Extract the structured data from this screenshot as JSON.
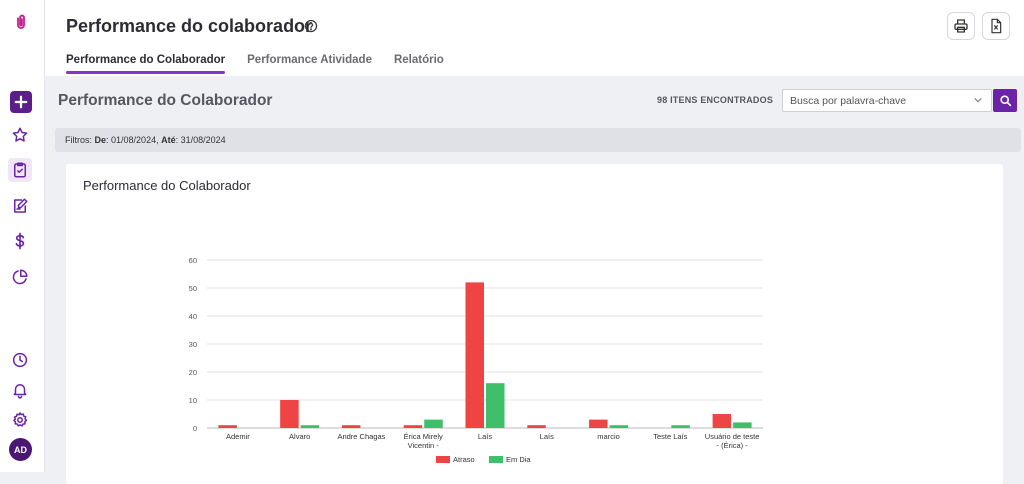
{
  "app": {
    "page_title": "Performance do colaborador",
    "tabs": [
      {
        "label": "Performance do Colaborador",
        "active": true
      },
      {
        "label": "Performance Atividade",
        "active": false
      },
      {
        "label": "Relatório",
        "active": false
      }
    ],
    "toolbar": {
      "print_icon": "printer-icon",
      "excel_icon": "excel-export-icon"
    }
  },
  "sidebar": {
    "items": [
      {
        "name": "add",
        "icon": "plus-icon"
      },
      {
        "name": "favorites",
        "icon": "star-icon"
      },
      {
        "name": "tasks",
        "icon": "clipboard-check-icon",
        "active": true
      },
      {
        "name": "notes",
        "icon": "edit-note-icon"
      },
      {
        "name": "finance",
        "icon": "dollar-icon"
      },
      {
        "name": "reports",
        "icon": "pie-chart-icon"
      },
      {
        "name": "history",
        "icon": "clock-icon"
      },
      {
        "name": "notifications",
        "icon": "bell-icon"
      },
      {
        "name": "settings",
        "icon": "gear-icon"
      }
    ],
    "avatar_initials": "AD"
  },
  "main": {
    "section_title": "Performance do Colaborador",
    "items_found": "98 ITENS ENCONTRADOS",
    "search_placeholder": "Busca por palavra-chave",
    "filters": {
      "prefix": "Filtros: ",
      "from_label": "De",
      "from_value": ": 01/08/2024, ",
      "to_label": "Até",
      "to_value": ": 31/08/2024"
    },
    "card_title": "Performance do Colaborador"
  },
  "colors": {
    "accent": "#8a33c9",
    "atraso": "#ef4444",
    "em_dia": "#3fbf6a"
  },
  "chart_data": {
    "type": "bar",
    "title": "",
    "categories": [
      "Ademir",
      "Alvaro",
      "Andre Chagas",
      "Érica Mirely Vicentin -",
      "Laís",
      "Laís",
      "marcio",
      "Teste Laís",
      "Usuário de teste - (Érica) -"
    ],
    "category_lines": [
      [
        "Ademir"
      ],
      [
        "Alvaro"
      ],
      [
        "Andre Chagas"
      ],
      [
        "Érica Mirely",
        "Vicentin -"
      ],
      [
        "Laís"
      ],
      [
        "Laís"
      ],
      [
        "marcio"
      ],
      [
        "Teste Laís"
      ],
      [
        "Usuário de teste",
        "- (Érica) -"
      ]
    ],
    "series": [
      {
        "name": "Atraso",
        "color": "#ef4444",
        "values": [
          1,
          10,
          1,
          1,
          52,
          1,
          3,
          0,
          5
        ]
      },
      {
        "name": "Em Dia",
        "color": "#3fbf6a",
        "values": [
          0,
          1,
          0,
          3,
          16,
          0,
          1,
          1,
          2
        ]
      }
    ],
    "ylim": [
      0,
      60
    ],
    "yticks": [
      0,
      10,
      20,
      30,
      40,
      50,
      60
    ],
    "grid": true,
    "legend": "bottom"
  }
}
